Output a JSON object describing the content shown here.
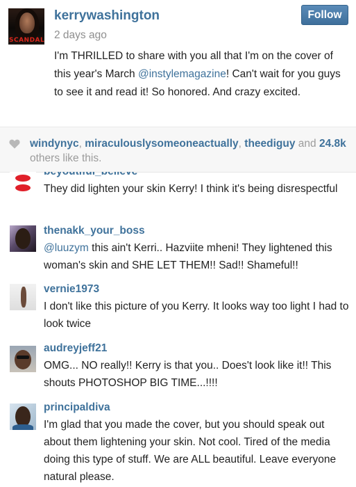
{
  "post": {
    "avatar_text": "SCANDAL",
    "username": "kerrywashington",
    "timestamp": "2 days ago",
    "follow_label": "Follow",
    "caption_before": "I'm THRILLED to share with you all that I'm on the cover of this year's March ",
    "caption_mention": "@instylemagazine",
    "caption_after": "! Can't wait for you guys to see it and read it! So honored. And crazy excited."
  },
  "likes": {
    "user1": "windynyc",
    "user2": "miraculouslysomeoneactually",
    "user3": "theediguy",
    "and_text": " and ",
    "count": "24.8k",
    "suffix": " others like this."
  },
  "comments": [
    {
      "username": "beyoutiful_believe",
      "text": "They did lighten your skin Kerry! I think it's being disrespectful"
    },
    {
      "username": "thenakk_your_boss",
      "mention": "@luuzym",
      "text": " this ain't Kerri.. Hazviite mheni! They lightened this woman's skin and SHE LET THEM!! Sad!! Shameful!!"
    },
    {
      "username": "vernie1973",
      "text": "I don't like this picture of you Kerry. It looks way too light I had to look twice"
    },
    {
      "username": "audreyjeff21",
      "text": "OMG... NO really!! Kerry is that you.. Does't look like it!! This shouts PHOTOSHOP BIG TIME...!!!!"
    },
    {
      "username": "principaldiva",
      "text": "I'm glad that you made the cover, but you should speak out about them lightening your skin. Not cool. Tired of the media doing this type of stuff. We are ALL beautiful. Leave everyone natural please."
    }
  ],
  "colors": {
    "username_blue": "#3f729b",
    "follow_button": "#4a7ba7",
    "meta_gray": "#8f8f8f",
    "likes_background": "#f7f7f7"
  },
  "icons": [
    "heart-icon"
  ]
}
